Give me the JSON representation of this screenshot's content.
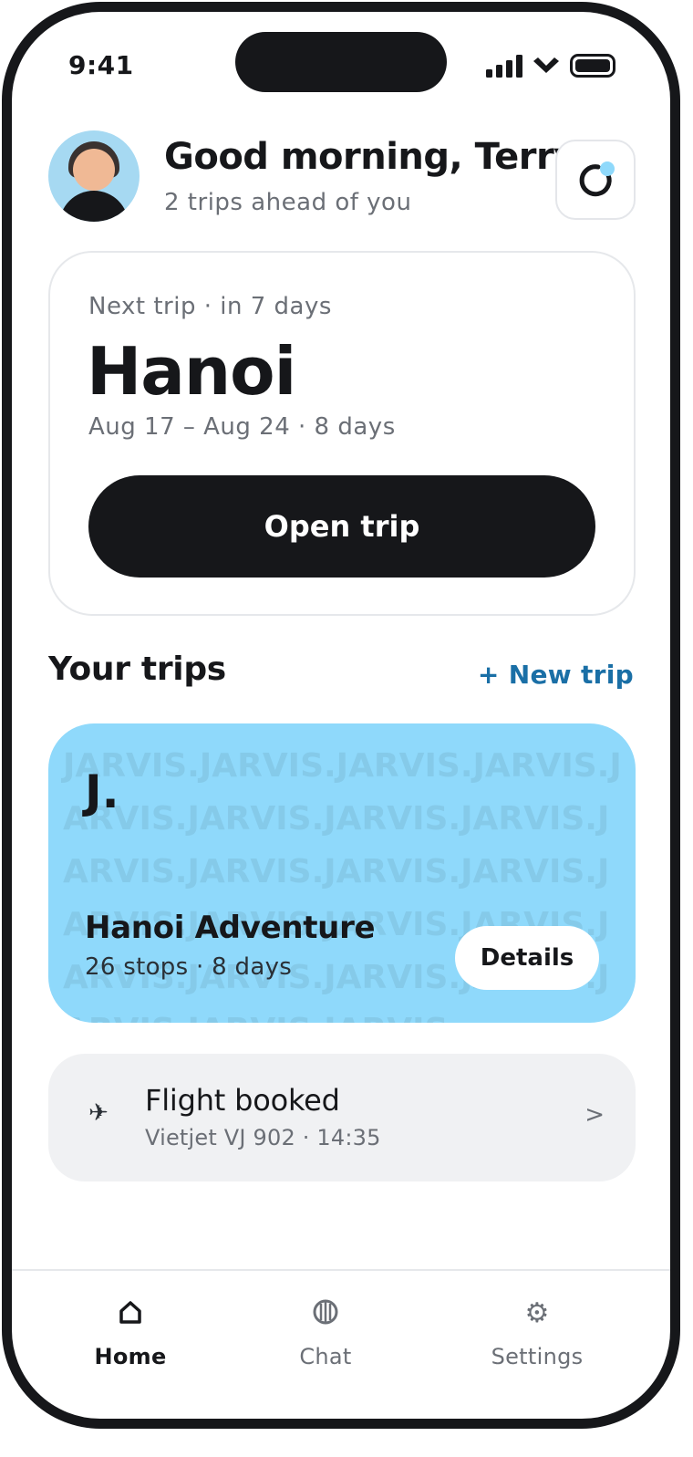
{
  "status_bar": {
    "time": "9:41",
    "icons": [
      "signal-icon",
      "wifi-icon",
      "battery-icon"
    ]
  },
  "header": {
    "greeting": "Good morning, Terry",
    "subtitle": "2 trips ahead of you",
    "avatar": "avatar",
    "refresh_icon": "refresh-icon"
  },
  "next_trip": {
    "label": "Next trip · in 7 days",
    "city": "Hanoi",
    "dates": "Aug 17 – Aug 24 · 8 days",
    "button": "Open trip"
  },
  "trips_section": {
    "title": "Your trips",
    "new_trip": "+ New trip"
  },
  "trip_card": {
    "pattern_text": "JARVIS.JARVIS.JARVIS.JARVIS.JARVIS.JARVIS.JARVIS.JARVIS.JARVIS.JARVIS.JARVIS.JARVIS.JARVIS.JARVIS.JARVIS.JARVIS.JARVIS.JARVIS.JARVIS.JARVIS.JARVIS.JARVIS.JARVIS.",
    "brand": "J.",
    "name": "Hanoi Adventure",
    "meta": "26 stops · 8 days",
    "details_button": "Details",
    "color": "#8fd9fb"
  },
  "flight_card": {
    "icon": "✈",
    "title": "Flight booked",
    "subtitle": "Vietjet VJ 902 · 14:35",
    "chevron": ">"
  },
  "tab_bar": {
    "tabs": [
      {
        "label": "Home",
        "icon": "home-icon",
        "active": true
      },
      {
        "label": "Chat",
        "icon": "chat-icon",
        "active": false
      },
      {
        "label": "Settings",
        "icon": "gear-icon",
        "active": false
      }
    ]
  },
  "colors": {
    "accent": "#1a6fa6",
    "dark": "#16171a",
    "muted": "#6b6f76",
    "sky": "#8fd9fb"
  }
}
